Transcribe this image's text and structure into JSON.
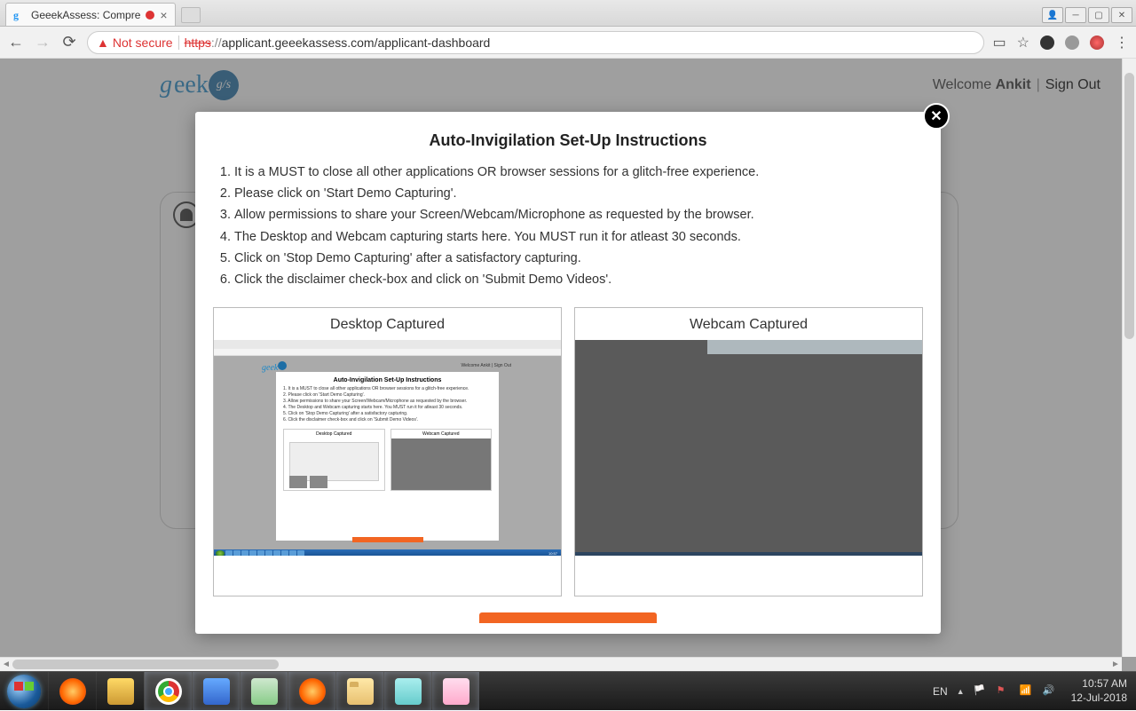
{
  "browser": {
    "tab_title": "GeeekAssess: Compre",
    "url_display": "applicant.geeekassess.com/applicant-dashboard",
    "url_protocol": "https",
    "not_secure_label": "Not secure"
  },
  "page_header": {
    "logo_text": "eek",
    "logo_badge": "g/s",
    "welcome_prefix": "Welcome ",
    "welcome_name": "Ankit",
    "separator": " | ",
    "signout": "Sign Out"
  },
  "modal": {
    "title": "Auto-Invigilation Set-Up Instructions",
    "steps": [
      "It is a MUST to close all other applications OR browser sessions for a glitch-free experience.",
      "Please click on 'Start Demo Capturing'.",
      "Allow permissions to share your Screen/Webcam/Microphone as requested by the browser.",
      "The Desktop and Webcam capturing starts here. You MUST run it for atleast 30 seconds.",
      "Click on 'Stop Demo Capturing' after a satisfactory capturing.",
      "Click the disclaimer check-box and click on 'Submit Demo Videos'."
    ],
    "desktop_label": "Desktop Captured",
    "webcam_label": "Webcam Captured"
  },
  "systray": {
    "lang": "EN",
    "time": "10:57 AM",
    "date": "12-Jul-2018"
  }
}
